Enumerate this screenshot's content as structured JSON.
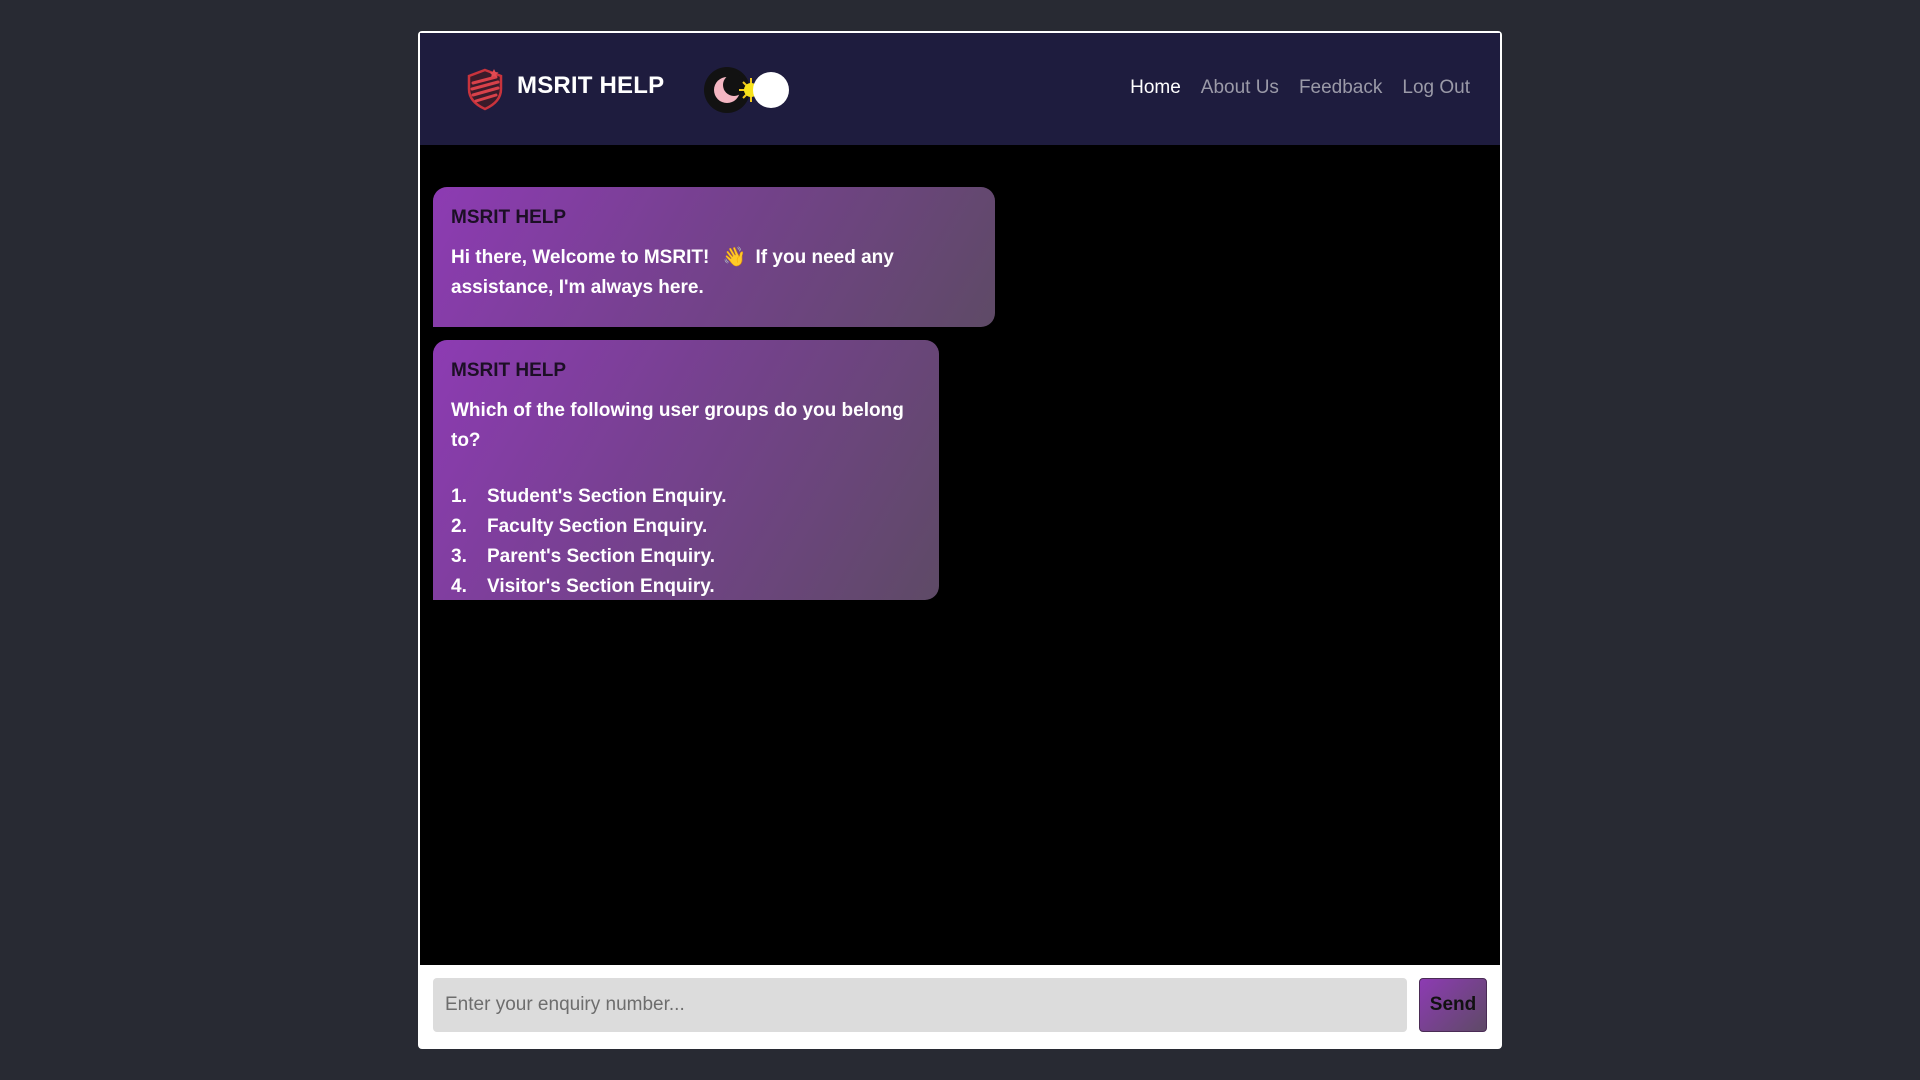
{
  "header": {
    "title": "MSRIT HELP",
    "logo_icon": "shield-logo-icon",
    "theme_toggle_icons": [
      "moon-icon",
      "sun-icon"
    ]
  },
  "nav": {
    "items": [
      {
        "label": "Home",
        "active": true
      },
      {
        "label": "About Us",
        "active": false
      },
      {
        "label": "Feedback",
        "active": false
      },
      {
        "label": "Log Out",
        "active": false
      }
    ]
  },
  "chat": {
    "messages": [
      {
        "sender": "MSRIT HELP",
        "text_before_emoji": "Hi there, Welcome to MSRIT!",
        "emoji": "👋",
        "text_after_emoji": "If you need any assistance, I'm always here."
      },
      {
        "sender": "MSRIT HELP",
        "text": "Which of the following user groups do you belong to?",
        "options": [
          {
            "num": "1.",
            "label": "Student's Section Enquiry."
          },
          {
            "num": "2.",
            "label": "Faculty Section Enquiry."
          },
          {
            "num": "3.",
            "label": "Parent's Section Enquiry."
          },
          {
            "num": "4.",
            "label": "Visitor's Section Enquiry."
          }
        ]
      }
    ]
  },
  "input": {
    "placeholder": "Enter your enquiry number...",
    "value": "",
    "send_label": "Send"
  },
  "colors": {
    "page_background": "#282a33",
    "navbar": "#1e1c3e",
    "chat_background": "#000000",
    "bubble_gradient_start": "#8d3bb3",
    "bubble_gradient_end": "#5e4a66"
  }
}
